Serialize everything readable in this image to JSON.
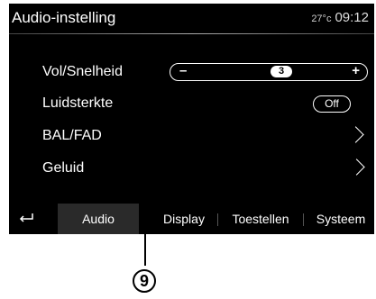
{
  "header": {
    "title": "Audio-instelling",
    "temperature": "27°c",
    "time": "09:12"
  },
  "rows": [
    {
      "label": "Vol/Snelheid",
      "control": "stepper",
      "minus": "–",
      "value": "3",
      "plus": "+"
    },
    {
      "label": "Luidsterkte",
      "control": "toggle",
      "value": "Off"
    },
    {
      "label": "BAL/FAD",
      "control": "chevron",
      "icon": "chevron-right-icon"
    },
    {
      "label": "Geluid",
      "control": "chevron",
      "icon": "chevron-right-icon"
    }
  ],
  "tabs": [
    {
      "label": "Audio",
      "selected": true
    },
    {
      "label": "Display",
      "selected": false
    },
    {
      "label": "Toestellen",
      "selected": false
    },
    {
      "label": "Systeem",
      "selected": false
    }
  ],
  "back_icon": "back-arrow-icon",
  "callout": {
    "number": "9"
  }
}
